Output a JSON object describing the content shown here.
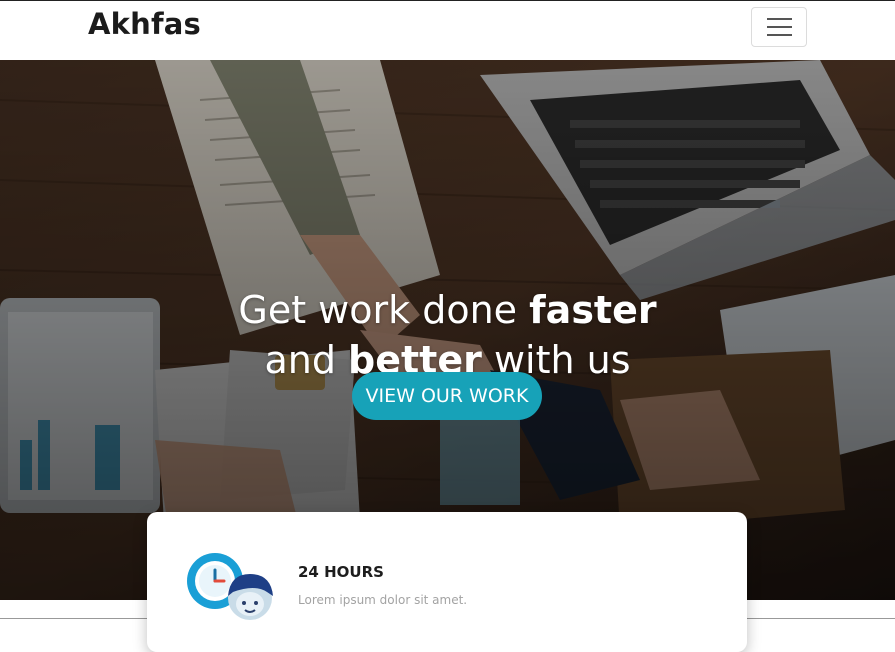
{
  "navbar": {
    "brand": "Akhfas",
    "toggle_icon": "hamburger-menu-icon"
  },
  "hero": {
    "headline_line1_light": "Get work done ",
    "headline_line1_bold": "faster",
    "headline_line2_light_a": "and ",
    "headline_line2_bold": "better",
    "headline_line2_light_b": " with us",
    "cta_label": "VIEW OUR WORK",
    "cta_color": "#17a2b8"
  },
  "feature_card": {
    "icon": "clock-support-agent-icon",
    "title": "24 HOURS",
    "text": "Lorem ipsum dolor sit amet."
  }
}
